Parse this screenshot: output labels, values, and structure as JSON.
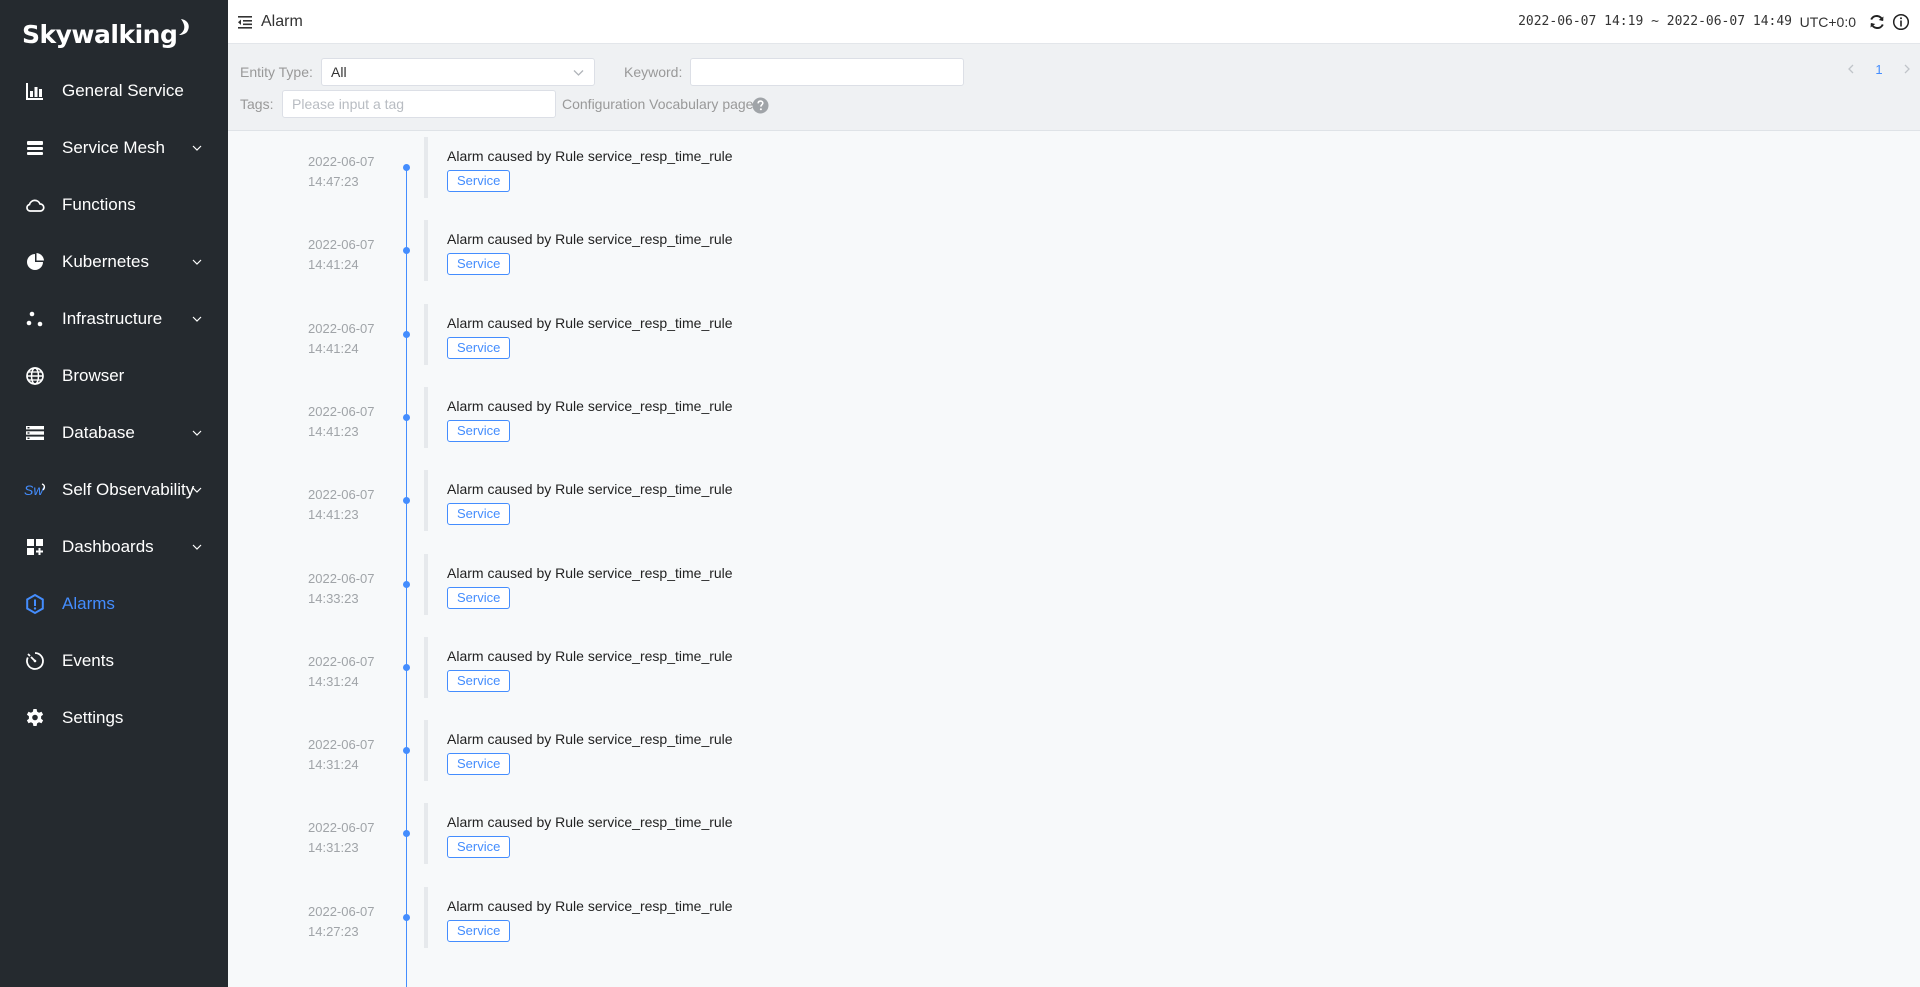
{
  "brand": {
    "logo_text": "Skywalking"
  },
  "colors": {
    "sidebar_bg": "#252a2f",
    "accent": "#448dfe"
  },
  "sidebar": {
    "items": [
      {
        "label": "General Service",
        "icon": "bar-chart-icon",
        "expandable": false,
        "active": false
      },
      {
        "label": "Service Mesh",
        "icon": "layers-icon",
        "expandable": true,
        "active": false
      },
      {
        "label": "Functions",
        "icon": "cloud-icon",
        "expandable": false,
        "active": false
      },
      {
        "label": "Kubernetes",
        "icon": "pie-chart-icon",
        "expandable": true,
        "active": false
      },
      {
        "label": "Infrastructure",
        "icon": "nodes-icon",
        "expandable": true,
        "active": false
      },
      {
        "label": "Browser",
        "icon": "globe-icon",
        "expandable": false,
        "active": false
      },
      {
        "label": "Database",
        "icon": "database-icon",
        "expandable": true,
        "active": false
      },
      {
        "label": "Self Observability",
        "icon": "sw-icon",
        "expandable": true,
        "active": false
      },
      {
        "label": "Dashboards",
        "icon": "dashboard-icon",
        "expandable": true,
        "active": false
      },
      {
        "label": "Alarms",
        "icon": "alarm-icon",
        "expandable": false,
        "active": true
      },
      {
        "label": "Events",
        "icon": "events-icon",
        "expandable": false,
        "active": false
      },
      {
        "label": "Settings",
        "icon": "gear-icon",
        "expandable": false,
        "active": false
      }
    ]
  },
  "header": {
    "title": "Alarm",
    "time_range": "2022-06-07 14:19 ~ 2022-06-07 14:49",
    "timezone": "UTC+0:0"
  },
  "filters": {
    "entity_type_label": "Entity Type:",
    "entity_type_value": "All",
    "keyword_label": "Keyword:",
    "keyword_value": "",
    "tags_label": "Tags:",
    "tags_placeholder": "Please input a tag",
    "vocab_link": "Configuration Vocabulary page",
    "page": "1"
  },
  "alarms": [
    {
      "date": "2022-06-07",
      "time": "14:47:23",
      "message": "Alarm caused by Rule service_resp_time_rule",
      "tag": "Service"
    },
    {
      "date": "2022-06-07",
      "time": "14:41:24",
      "message": "Alarm caused by Rule service_resp_time_rule",
      "tag": "Service"
    },
    {
      "date": "2022-06-07",
      "time": "14:41:24",
      "message": "Alarm caused by Rule service_resp_time_rule",
      "tag": "Service"
    },
    {
      "date": "2022-06-07",
      "time": "14:41:23",
      "message": "Alarm caused by Rule service_resp_time_rule",
      "tag": "Service"
    },
    {
      "date": "2022-06-07",
      "time": "14:41:23",
      "message": "Alarm caused by Rule service_resp_time_rule",
      "tag": "Service"
    },
    {
      "date": "2022-06-07",
      "time": "14:33:23",
      "message": "Alarm caused by Rule service_resp_time_rule",
      "tag": "Service"
    },
    {
      "date": "2022-06-07",
      "time": "14:31:24",
      "message": "Alarm caused by Rule service_resp_time_rule",
      "tag": "Service"
    },
    {
      "date": "2022-06-07",
      "time": "14:31:24",
      "message": "Alarm caused by Rule service_resp_time_rule",
      "tag": "Service"
    },
    {
      "date": "2022-06-07",
      "time": "14:31:23",
      "message": "Alarm caused by Rule service_resp_time_rule",
      "tag": "Service"
    },
    {
      "date": "2022-06-07",
      "time": "14:27:23",
      "message": "Alarm caused by Rule service_resp_time_rule",
      "tag": "Service"
    }
  ]
}
